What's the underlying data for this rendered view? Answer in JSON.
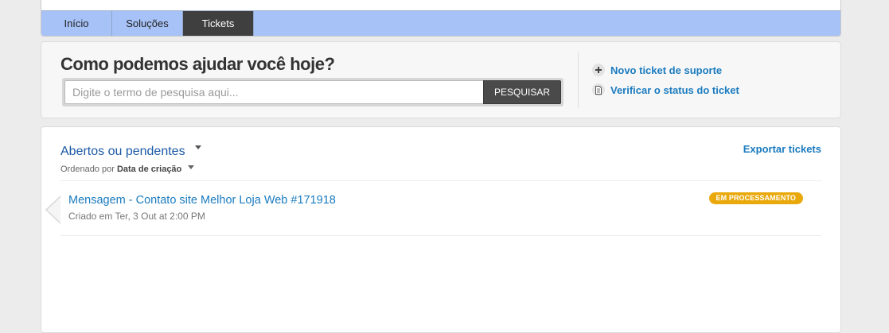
{
  "nav": {
    "tabs": [
      {
        "label": "Início"
      },
      {
        "label": "Soluções"
      },
      {
        "label": "Tickets"
      }
    ],
    "active_tab": "Tickets"
  },
  "search": {
    "title": "Como podemos ajudar você hoje?",
    "placeholder": "Digite o termo de pesquisa aqui...",
    "button_label": "PESQUISAR"
  },
  "actions": {
    "new_ticket": {
      "label": "Novo ticket de suporte",
      "icon": "plus-icon"
    },
    "check_status": {
      "label": "Verificar o status do ticket",
      "icon": "document-icon"
    }
  },
  "tickets": {
    "filter_label": "Abertos ou pendentes",
    "sort_prefix": "Ordenado por",
    "sort_value": "Data de criação",
    "export_label": "Exportar tickets",
    "items": [
      {
        "subject": "Mensagem - Contato site Melhor Loja Web #171918",
        "meta": "Criado em Ter, 3 Out at 2:00 PM",
        "status": "EM PROCESSAMENTO"
      }
    ]
  },
  "colors": {
    "tab_bar": "#a7c2f7",
    "active_tab": "#3f3f3f",
    "link": "#1a7bbf",
    "status_badge": "#e9a90c"
  }
}
